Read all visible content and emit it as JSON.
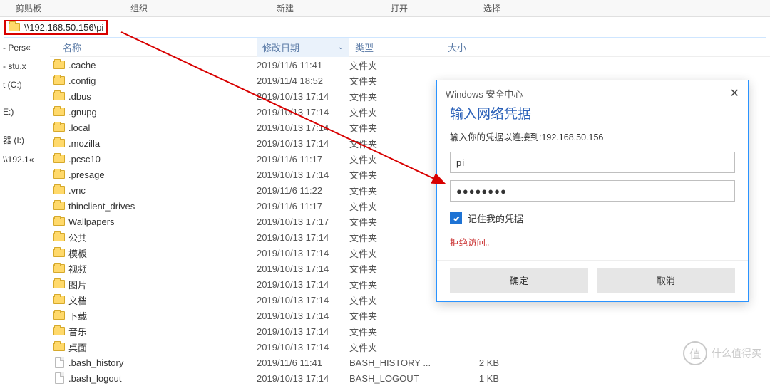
{
  "ribbon_groups": [
    "剪贴板",
    "组织",
    "新建",
    "打开",
    "选择"
  ],
  "address": "\\\\192.168.50.156\\pi",
  "tree": [
    "- Pers«",
    "- stu.x",
    "t (C:)",
    "",
    "E:)",
    "",
    "器 (I:)",
    "\\\\192.1«"
  ],
  "columns": {
    "name": "名称",
    "date": "修改日期",
    "type": "类型",
    "size": "大小"
  },
  "rows": [
    {
      "icon": "folder",
      "name": ".cache",
      "date": "2019/11/6 11:41",
      "type": "文件夹",
      "size": ""
    },
    {
      "icon": "folder",
      "name": ".config",
      "date": "2019/11/4 18:52",
      "type": "文件夹",
      "size": ""
    },
    {
      "icon": "folder",
      "name": ".dbus",
      "date": "2019/10/13 17:14",
      "type": "文件夹",
      "size": ""
    },
    {
      "icon": "folder",
      "name": ".gnupg",
      "date": "2019/10/13 17:14",
      "type": "文件夹",
      "size": ""
    },
    {
      "icon": "folder",
      "name": ".local",
      "date": "2019/10/13 17:14",
      "type": "文件夹",
      "size": ""
    },
    {
      "icon": "folder",
      "name": ".mozilla",
      "date": "2019/10/13 17:14",
      "type": "文件夹",
      "size": ""
    },
    {
      "icon": "folder",
      "name": ".pcsc10",
      "date": "2019/11/6 11:17",
      "type": "文件夹",
      "size": ""
    },
    {
      "icon": "folder",
      "name": ".presage",
      "date": "2019/10/13 17:14",
      "type": "文件夹",
      "size": ""
    },
    {
      "icon": "folder",
      "name": ".vnc",
      "date": "2019/11/6 11:22",
      "type": "文件夹",
      "size": ""
    },
    {
      "icon": "folder",
      "name": "thinclient_drives",
      "date": "2019/11/6 11:17",
      "type": "文件夹",
      "size": ""
    },
    {
      "icon": "folder",
      "name": "Wallpapers",
      "date": "2019/10/13 17:17",
      "type": "文件夹",
      "size": ""
    },
    {
      "icon": "folder",
      "name": "公共",
      "date": "2019/10/13 17:14",
      "type": "文件夹",
      "size": ""
    },
    {
      "icon": "folder",
      "name": "模板",
      "date": "2019/10/13 17:14",
      "type": "文件夹",
      "size": ""
    },
    {
      "icon": "folder",
      "name": "视频",
      "date": "2019/10/13 17:14",
      "type": "文件夹",
      "size": ""
    },
    {
      "icon": "folder",
      "name": "图片",
      "date": "2019/10/13 17:14",
      "type": "文件夹",
      "size": ""
    },
    {
      "icon": "folder",
      "name": "文档",
      "date": "2019/10/13 17:14",
      "type": "文件夹",
      "size": ""
    },
    {
      "icon": "folder",
      "name": "下载",
      "date": "2019/10/13 17:14",
      "type": "文件夹",
      "size": ""
    },
    {
      "icon": "folder",
      "name": "音乐",
      "date": "2019/10/13 17:14",
      "type": "文件夹",
      "size": ""
    },
    {
      "icon": "folder",
      "name": "桌面",
      "date": "2019/10/13 17:14",
      "type": "文件夹",
      "size": ""
    },
    {
      "icon": "file",
      "name": ".bash_history",
      "date": "2019/11/6 11:41",
      "type": "BASH_HISTORY ...",
      "size": "2 KB"
    },
    {
      "icon": "file",
      "name": ".bash_logout",
      "date": "2019/10/13 17:14",
      "type": "BASH_LOGOUT",
      "size": "1 KB"
    }
  ],
  "dialog": {
    "caption": "Windows 安全中心",
    "title": "输入网络凭据",
    "subtitle": "输入你的凭据以连接到:192.168.50.156",
    "username": "pi",
    "password": "●●●●●●●●",
    "remember": "记住我的凭据",
    "error": "拒绝访问。",
    "ok": "确定",
    "cancel": "取消"
  },
  "watermark": "什么值得买"
}
